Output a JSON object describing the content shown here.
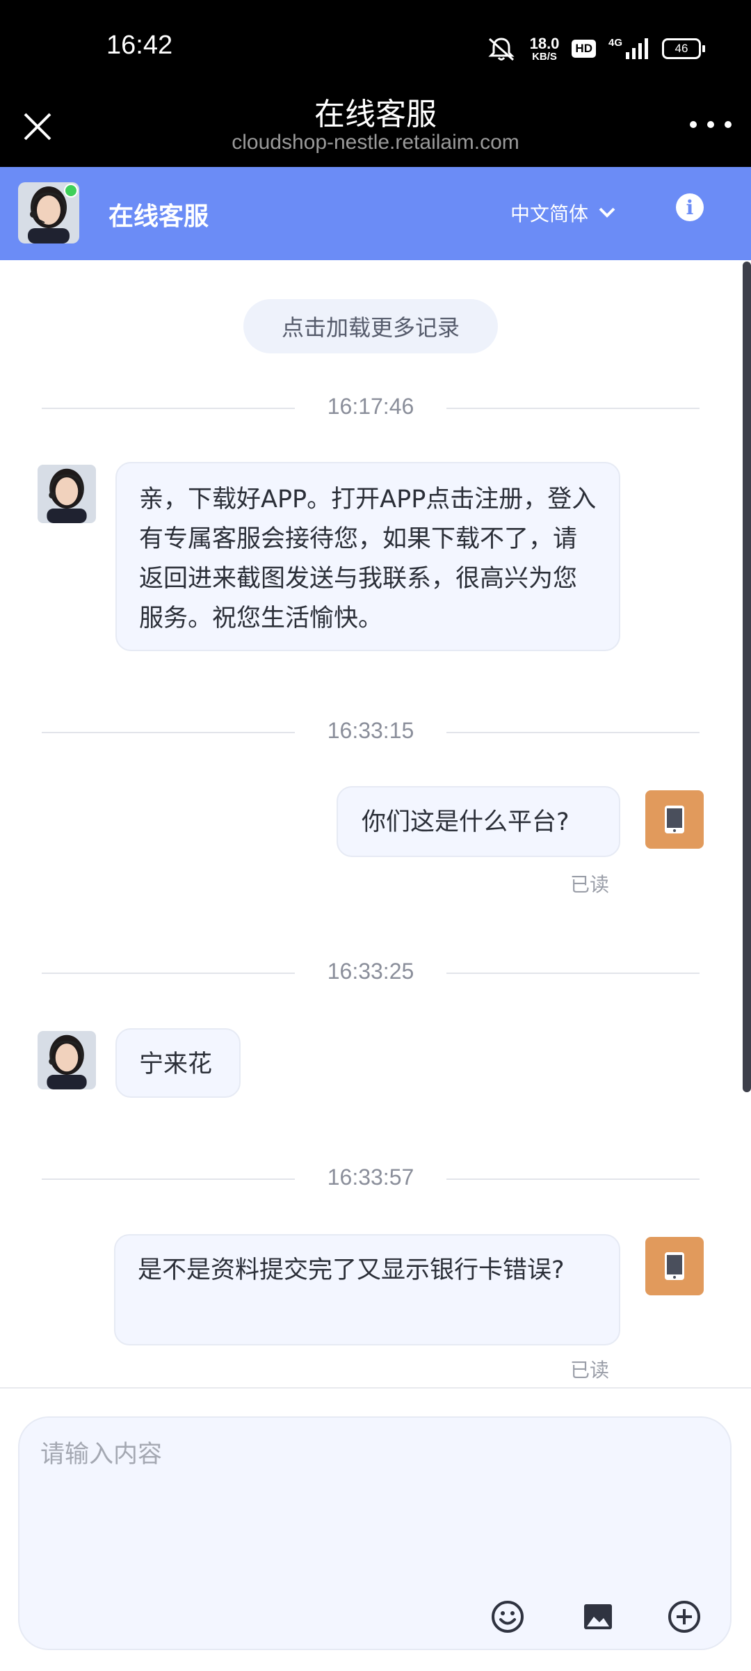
{
  "status_bar": {
    "time": "16:42",
    "net_speed_value": "18.0",
    "net_speed_unit": "KB/S",
    "hd_label": "HD",
    "network": "4G",
    "battery": "46"
  },
  "title_bar": {
    "title": "在线客服",
    "url": "cloudshop-nestle.retailaim.com"
  },
  "header": {
    "title": "在线客服",
    "language": "中文简体",
    "accent_color": "#6b8cf6"
  },
  "chat": {
    "load_more": "点击加载更多记录",
    "groups": [
      {
        "time": "16:17:46",
        "sender": "agent",
        "text": " 亲，下载好APP。打开APP点击注册，登入有专属客服会接待您，如果下载不了，请返回进来截图发送与我联系，很高兴为您服务。祝您生活愉快。"
      },
      {
        "time": "16:33:15",
        "sender": "user",
        "text": "你们这是什么平台?",
        "status": "已读"
      },
      {
        "time": "16:33:25",
        "sender": "agent",
        "text": "宁来花"
      },
      {
        "time": "16:33:57",
        "sender": "user",
        "text": "是不是资料提交完了又显示银行卡错误?",
        "status": "已读"
      }
    ]
  },
  "input": {
    "placeholder": "请输入内容"
  },
  "icons": {
    "close": "close-icon",
    "more": "more-icon",
    "info": "info-icon",
    "emoji": "emoji-icon",
    "image": "image-icon",
    "plus": "plus-icon",
    "device": "phone-device-icon"
  }
}
